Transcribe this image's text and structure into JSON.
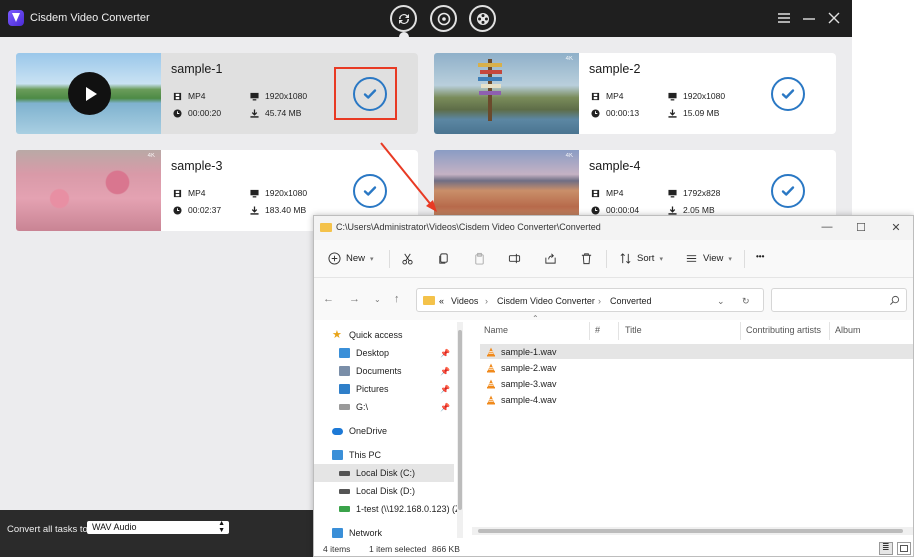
{
  "app": {
    "title": "Cisdem Video Converter",
    "accent": "#2a78c4",
    "highlight_color": "#e83a24",
    "modes": [
      {
        "icon": "convert-mode-icon",
        "active": true
      },
      {
        "icon": "rip-mode-icon",
        "active": false
      },
      {
        "icon": "film-reel-icon",
        "active": false
      }
    ],
    "window_controls": [
      "menu-icon",
      "minimize-icon",
      "close-icon"
    ]
  },
  "tasks": [
    {
      "name": "sample-1",
      "format": "MP4",
      "resolution": "1920x1080",
      "duration": "00:00:20",
      "size": "45.74 MB",
      "selected": true,
      "status_icon": "check-done-icon"
    },
    {
      "name": "sample-2",
      "format": "MP4",
      "resolution": "1920x1080",
      "duration": "00:00:13",
      "size": "15.09 MB",
      "selected": false,
      "status_icon": "check-done-icon"
    },
    {
      "name": "sample-3",
      "format": "MP4",
      "resolution": "1920x1080",
      "duration": "00:02:37",
      "size": "183.40 MB",
      "selected": false,
      "status_icon": "check-done-icon"
    },
    {
      "name": "sample-4",
      "format": "MP4",
      "resolution": "1792x828",
      "duration": "00:00:04",
      "size": "2.05 MB",
      "selected": false,
      "status_icon": "check-done-icon"
    }
  ],
  "bottom": {
    "convert_label": "Convert all tasks to",
    "format_value": "WAV Audio"
  },
  "explorer": {
    "title_path": "C:\\Users\\Administrator\\Videos\\Cisdem Video Converter\\Converted",
    "toolbar": {
      "new": "New",
      "sort": "Sort",
      "view": "View",
      "more": "•••"
    },
    "breadcrumb": {
      "prefix": "«",
      "crumbs": [
        "Videos",
        "Cisdem Video Converter",
        "Converted"
      ]
    },
    "nav": [
      {
        "label": "Quick access",
        "icon": "star-icon",
        "pinned": false
      },
      {
        "label": "Desktop",
        "icon": "desktop-icon",
        "pinned": true
      },
      {
        "label": "Documents",
        "icon": "documents-icon",
        "pinned": true
      },
      {
        "label": "Pictures",
        "icon": "pictures-icon",
        "pinned": true
      },
      {
        "label": "G:\\",
        "icon": "drive-icon",
        "pinned": true
      },
      {
        "label": "OneDrive",
        "icon": "cloud-icon",
        "pinned": false
      },
      {
        "label": "This PC",
        "icon": "computer-icon",
        "pinned": false
      },
      {
        "label": "Local Disk (C:)",
        "icon": "disk-icon",
        "pinned": false,
        "active": true
      },
      {
        "label": "Local Disk (D:)",
        "icon": "disk-icon",
        "pinned": false
      },
      {
        "label": "1-test (\\\\192.168.0.123) (Z",
        "icon": "network-drive-icon",
        "pinned": false
      },
      {
        "label": "Network",
        "icon": "network-icon",
        "pinned": false
      }
    ],
    "columns": [
      "Name",
      "#",
      "Title",
      "Contributing artists",
      "Album"
    ],
    "files": [
      {
        "name": "sample-1.wav",
        "selected": true
      },
      {
        "name": "sample-2.wav",
        "selected": false
      },
      {
        "name": "sample-3.wav",
        "selected": false
      },
      {
        "name": "sample-4.wav",
        "selected": false
      }
    ],
    "status": {
      "items": "4 items",
      "selected": "1 item selected",
      "size": "866 KB"
    }
  }
}
